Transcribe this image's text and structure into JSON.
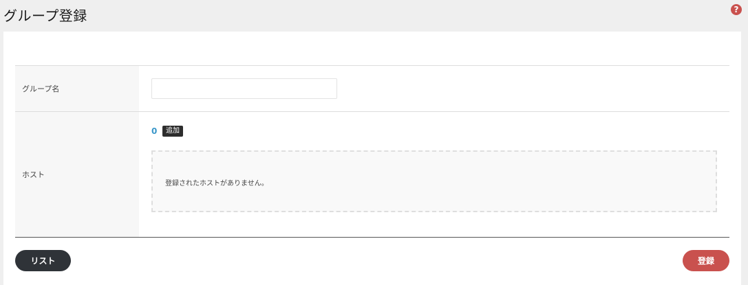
{
  "header": {
    "title": "グループ登録",
    "help_icon": "question-circle-icon",
    "help_symbol": "?"
  },
  "form": {
    "group_name": {
      "label": "グループ名",
      "value": "",
      "placeholder": ""
    },
    "host": {
      "label": "ホスト",
      "count": "0",
      "add_label": "追加",
      "empty_message": "登録されたホストがありません。"
    }
  },
  "actions": {
    "list_label": "リスト",
    "register_label": "登録"
  },
  "colors": {
    "accent_red": "#c9514e",
    "dark_button": "#2f3338",
    "count_blue": "#3a97c9"
  }
}
